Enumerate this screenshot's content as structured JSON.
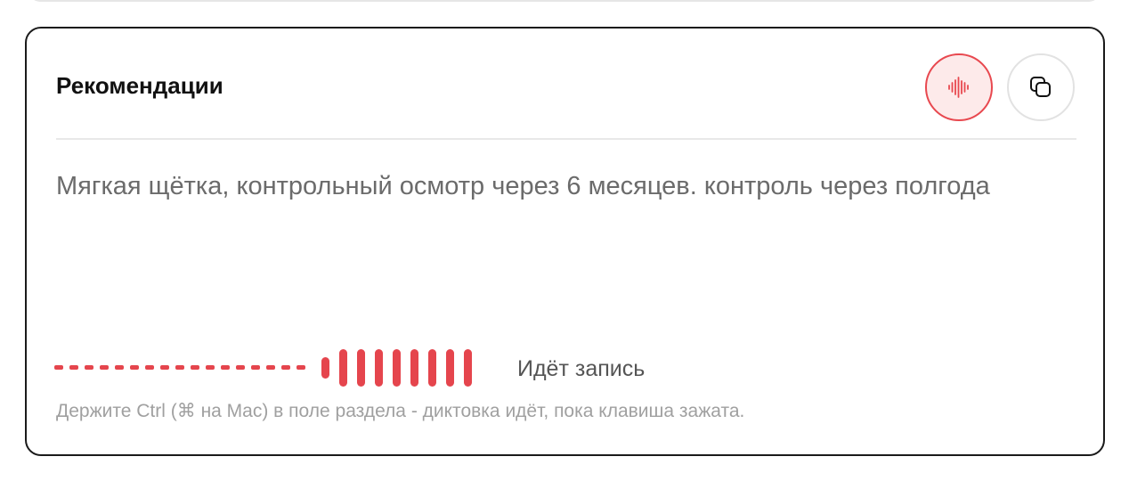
{
  "section": {
    "title": "Рекомендации",
    "body_text": "Мягкая щётка, контрольный осмотр через 6 месяцев. контроль через полгода"
  },
  "buttons": {
    "dictation": {
      "icon": "waveform-icon",
      "state": "recording",
      "accent_color": "#e8484f"
    },
    "copy": {
      "icon": "copy-icon"
    }
  },
  "recording": {
    "status_label": "Идёт запись",
    "color": "#e5454d",
    "levels": [
      0.5,
      0.88,
      0.88,
      0.88,
      0.88,
      0.88,
      0.88,
      0.88,
      0.88
    ]
  },
  "hint": "Держите Ctrl (⌘ на Mac) в поле раздела - диктовка идёт, пока клавиша зажата."
}
